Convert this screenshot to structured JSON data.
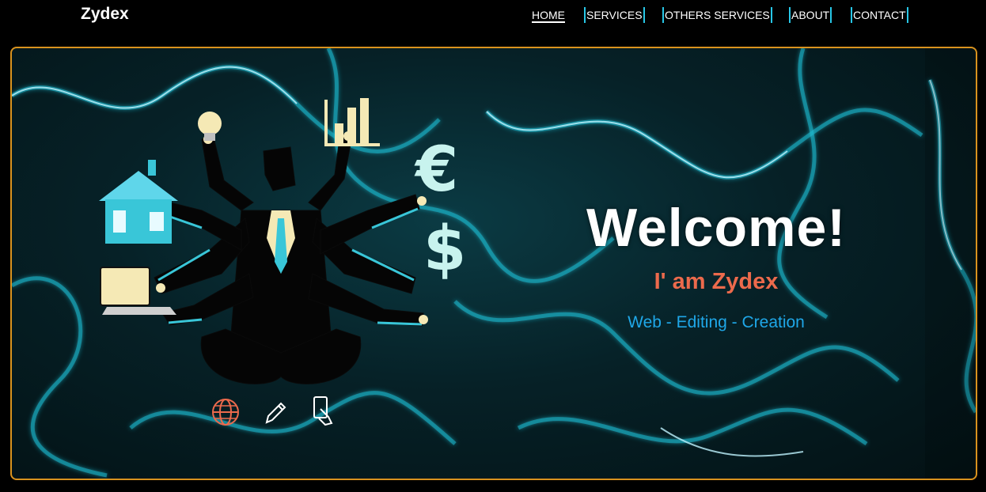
{
  "header": {
    "logo": "Zydex",
    "nav": [
      {
        "label": "HOME",
        "active": true
      },
      {
        "label": "SERVICES",
        "active": false
      },
      {
        "label": "OTHERS SERVICES",
        "active": false
      },
      {
        "label": "ABOUT",
        "active": false
      },
      {
        "label": "CONTACT",
        "active": false
      }
    ]
  },
  "hero": {
    "welcome": "Welcome!",
    "tagline": "I' am Zydex",
    "skills": "Web - Editing - Creation",
    "illustration": {
      "icons": [
        "house-icon",
        "lightbulb-icon",
        "bar-chart-icon",
        "euro-icon",
        "dollar-icon",
        "laptop-icon"
      ]
    },
    "social_icons": [
      "globe-icon",
      "pencil-icon",
      "phone-touch-icon"
    ]
  },
  "colors": {
    "background": "#000000",
    "nav_accent": "#27c6e6",
    "hero_border": "#d9921e",
    "tagline": "#ec6a4c",
    "skills": "#1fa7e8",
    "illustration_cream": "#f5e9b5",
    "illustration_teal": "#39c6d8"
  }
}
